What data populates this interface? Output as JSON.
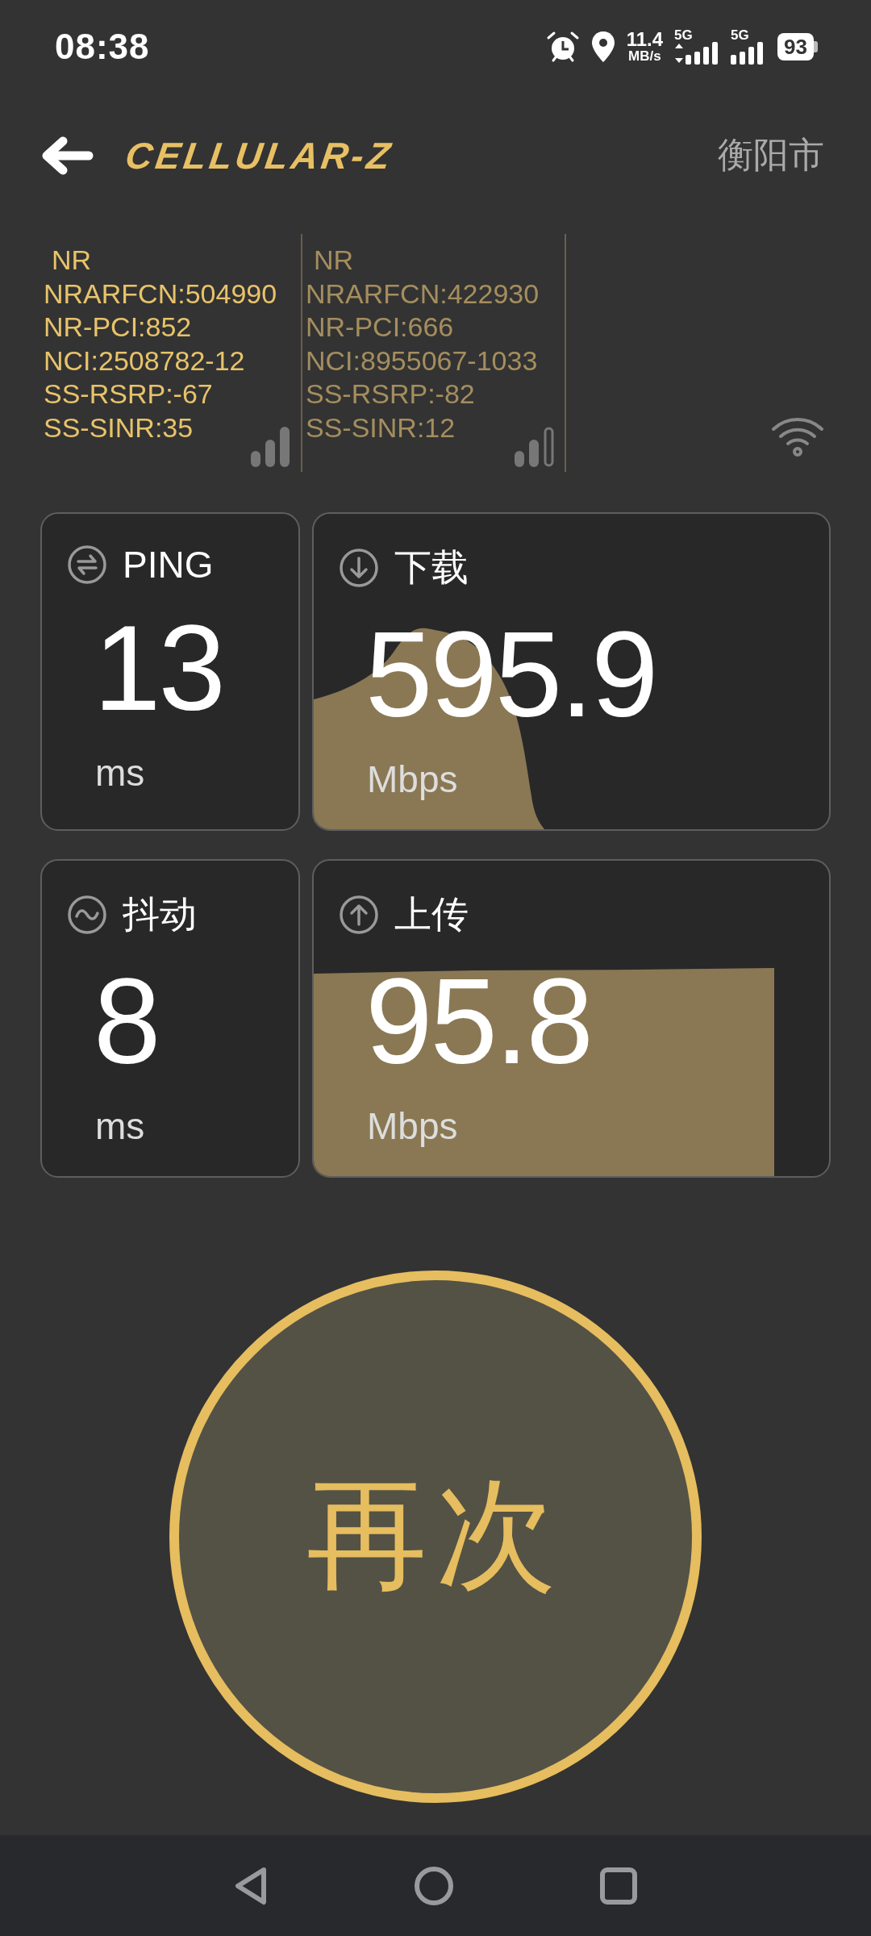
{
  "status_bar": {
    "time": "08:38",
    "speed": "11.4",
    "speed_unit": "MB/s",
    "networks": [
      {
        "label": "5G",
        "data_arrows": true
      },
      {
        "label": "5G",
        "data_arrows": false
      }
    ],
    "battery": "93"
  },
  "header": {
    "logo": "CELLULAR-Z",
    "city": "衡阳市"
  },
  "cells": [
    {
      "primary": true,
      "lines": [
        "NR",
        "NRARFCN:504990",
        "NR-PCI:852",
        "NCI:2508782-12",
        "SS-RSRP:-67",
        "SS-SINR:35"
      ]
    },
    {
      "primary": false,
      "lines": [
        "NR",
        "NRARFCN:422930",
        "NR-PCI:666",
        "NCI:8955067-1033",
        "SS-RSRP:-82",
        "SS-SINR:12"
      ]
    }
  ],
  "metrics": [
    {
      "kind": "ping",
      "label": "PING",
      "value": "13",
      "unit": "ms"
    },
    {
      "kind": "download",
      "label": "下载",
      "value": "595.9",
      "unit": "Mbps"
    },
    {
      "kind": "jitter",
      "label": "抖动",
      "value": "8",
      "unit": "ms"
    },
    {
      "kind": "upload",
      "label": "上传",
      "value": "95.8",
      "unit": "Mbps"
    }
  ],
  "action_button": {
    "label": "再次"
  }
}
